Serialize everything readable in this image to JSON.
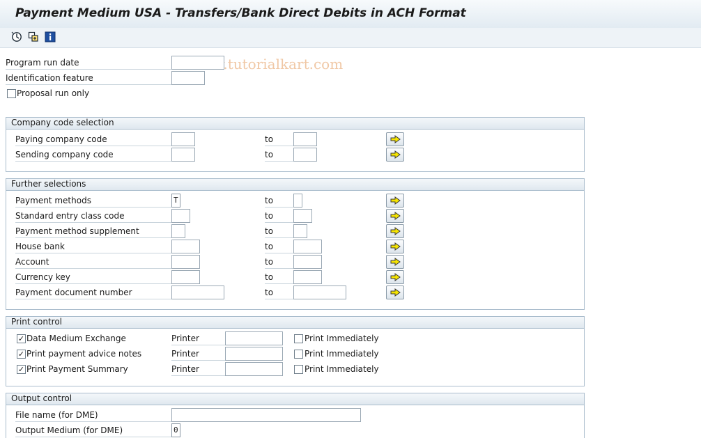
{
  "window": {
    "title": "Payment Medium USA - Transfers/Bank Direct Debits in ACH Format"
  },
  "toolbar": {
    "icons": [
      "execute-icon",
      "copy-variant-icon",
      "info-icon"
    ],
    "watermark": "© www.tutorialkart.com"
  },
  "general": {
    "run_date_label": "Program run date",
    "run_date_value": "",
    "id_feature_label": "Identification feature",
    "id_feature_value": "",
    "proposal_label": "Proposal run only",
    "proposal_checked": false
  },
  "company_code": {
    "title": "Company code selection",
    "to_label": "to",
    "rows": [
      {
        "label": "Paying company code",
        "from": "",
        "to": ""
      },
      {
        "label": "Sending company code",
        "from": "",
        "to": ""
      }
    ]
  },
  "further": {
    "title": "Further selections",
    "to_label": "to",
    "rows": [
      {
        "label": "Payment methods",
        "from": "T",
        "to": ""
      },
      {
        "label": "Standard entry class code",
        "from": "",
        "to": ""
      },
      {
        "label": "Payment method supplement",
        "from": "",
        "to": ""
      },
      {
        "label": "House bank",
        "from": "",
        "to": ""
      },
      {
        "label": "Account",
        "from": "",
        "to": ""
      },
      {
        "label": "Currency key",
        "from": "",
        "to": ""
      },
      {
        "label": "Payment document number",
        "from": "",
        "to": ""
      }
    ]
  },
  "print_control": {
    "title": "Print control",
    "printer_label": "Printer",
    "immediately_label": "Print Immediately",
    "rows": [
      {
        "label": "Data Medium Exchange",
        "checked": true,
        "printer": "",
        "immediately": false
      },
      {
        "label": "Print payment advice notes",
        "checked": true,
        "printer": "",
        "immediately": false
      },
      {
        "label": "Print Payment Summary",
        "checked": true,
        "printer": "",
        "immediately": false
      }
    ]
  },
  "output_control": {
    "title": "Output control",
    "file_name_label": "File name (for DME)",
    "file_name_value": "",
    "output_medium_label": "Output Medium (for DME)",
    "output_medium_value": "0"
  },
  "colors": {
    "arrow_fill": "#f5e400",
    "group_border": "#a9bccc",
    "watermark": "#f0c8a6"
  }
}
